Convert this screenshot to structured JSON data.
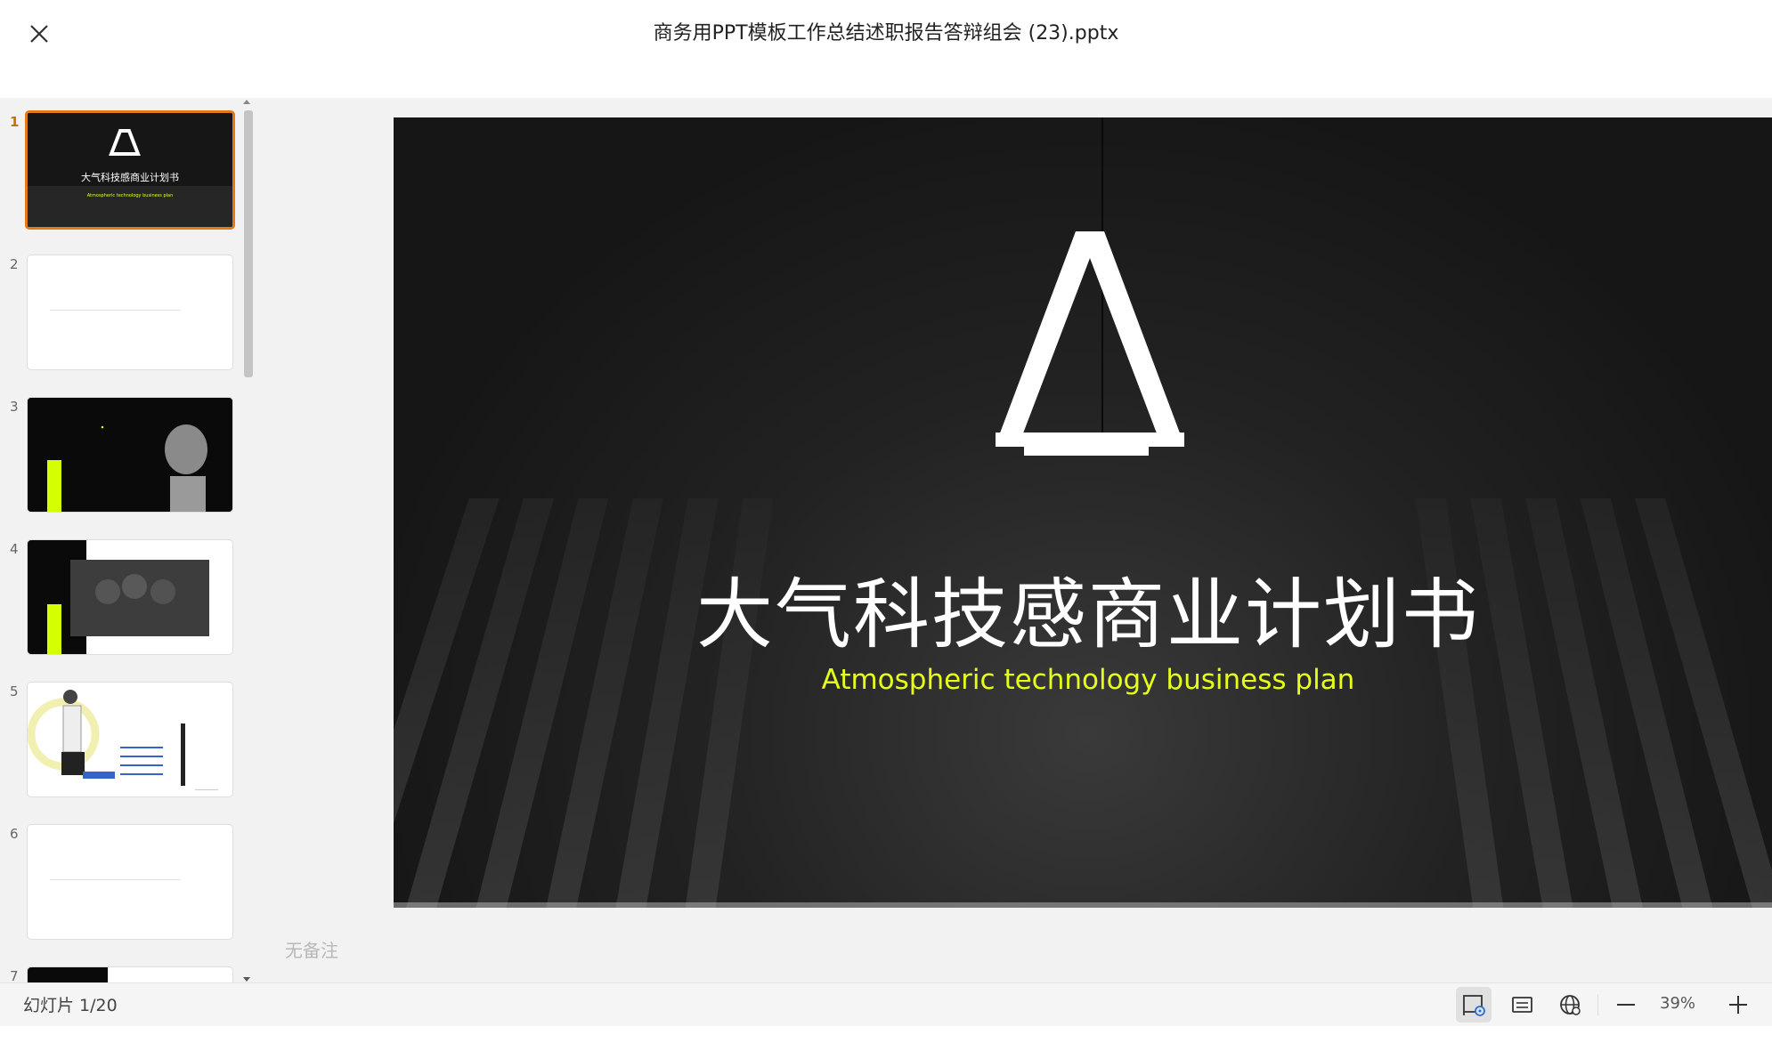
{
  "window": {
    "title": "商务用PPT模板工作总结述职报告答辩组会 (23).pptx",
    "close_icon": "close-icon"
  },
  "thumbnails": [
    {
      "number": "1",
      "title": "大气科技感商业计划书",
      "subtitle": "Atmospheric technology business plan",
      "active": true
    },
    {
      "number": "2"
    },
    {
      "number": "3"
    },
    {
      "number": "4"
    },
    {
      "number": "5"
    },
    {
      "number": "6"
    },
    {
      "number": "7"
    }
  ],
  "slide": {
    "title": "大气科技感商业计划书",
    "subtitle": "Atmospheric technology business plan",
    "subtitle_color": "#e6ff1a",
    "background_color": "#1a1a1a"
  },
  "notes": {
    "placeholder": "无备注"
  },
  "statusbar": {
    "slide_counter": "幻灯片 1/20",
    "zoom": "39%",
    "buttons": [
      "reading-view-icon",
      "notes-view-icon",
      "web-view-icon",
      "zoom-out-icon",
      "zoom-in-icon"
    ]
  },
  "colors": {
    "accent_active": "#e07b16",
    "workspace_bg": "#f2f2f2"
  }
}
